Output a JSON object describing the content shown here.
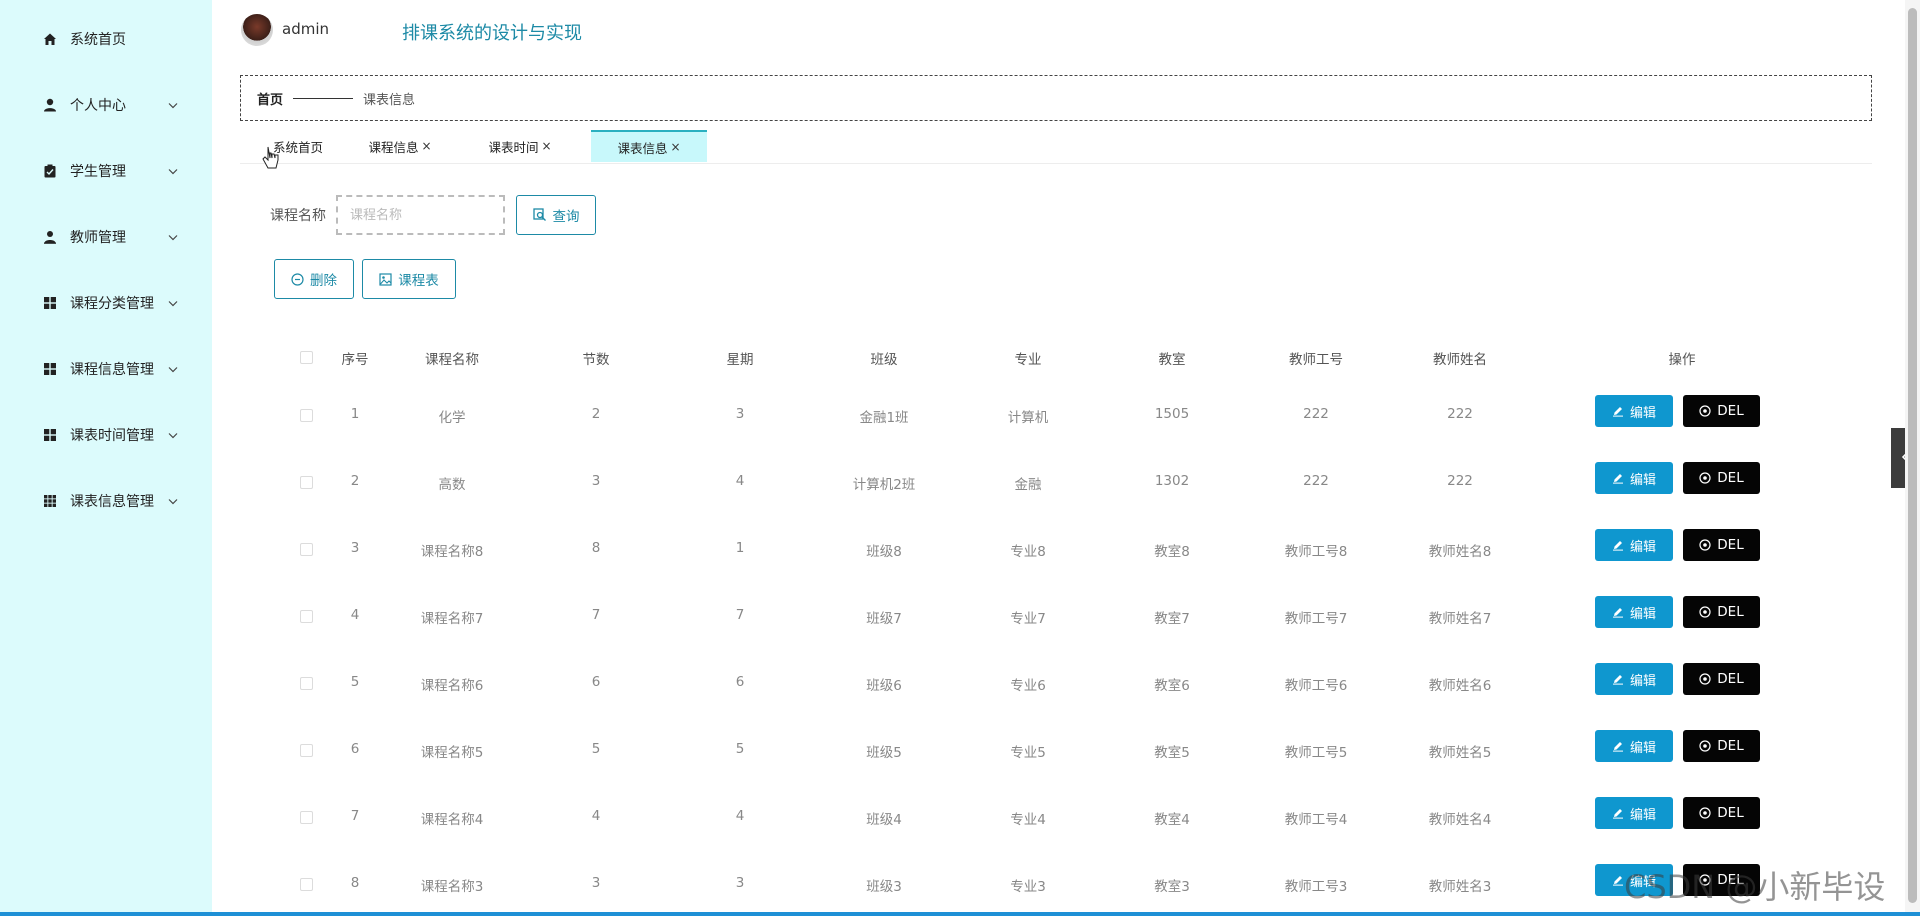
{
  "header": {
    "username": "admin",
    "system_title": "排课系统的设计与实现"
  },
  "sidebar": {
    "items": [
      {
        "label": "系统首页",
        "icon": "home-icon",
        "has_submenu": false
      },
      {
        "label": "个人中心",
        "icon": "user-icon",
        "has_submenu": true
      },
      {
        "label": "学生管理",
        "icon": "clipboard-icon",
        "has_submenu": true
      },
      {
        "label": "教师管理",
        "icon": "teacher-icon",
        "has_submenu": true
      },
      {
        "label": "课程分类管理",
        "icon": "grid-icon",
        "has_submenu": true
      },
      {
        "label": "课程信息管理",
        "icon": "grid-icon",
        "has_submenu": true
      },
      {
        "label": "课表时间管理",
        "icon": "grid-icon",
        "has_submenu": true
      },
      {
        "label": "课表信息管理",
        "icon": "grid-nine-icon",
        "has_submenu": true
      }
    ]
  },
  "breadcrumb": {
    "home": "首页",
    "current": "课表信息"
  },
  "tabs": [
    {
      "label": "系统首页",
      "closable": false,
      "active": false
    },
    {
      "label": "课程信息",
      "closable": true,
      "active": false
    },
    {
      "label": "课表时间",
      "closable": true,
      "active": false
    },
    {
      "label": "课表信息",
      "closable": true,
      "active": true
    }
  ],
  "tab_close_glyph": "×",
  "search": {
    "label": "课程名称",
    "placeholder": "课程名称",
    "value": "",
    "query_button": "查询"
  },
  "actions": {
    "delete_button": "删除",
    "schedule_button": "课程表"
  },
  "table": {
    "columns": [
      "序号",
      "课程名称",
      "节数",
      "星期",
      "班级",
      "专业",
      "教室",
      "教师工号",
      "教师姓名",
      "操作"
    ],
    "edit_label": "编辑",
    "del_label": "DEL",
    "rows": [
      [
        "1",
        "化学",
        "2",
        "3",
        "金融1班",
        "计算机",
        "1505",
        "222",
        "222"
      ],
      [
        "2",
        "高数",
        "3",
        "4",
        "计算机2班",
        "金融",
        "1302",
        "222",
        "222"
      ],
      [
        "3",
        "课程名称8",
        "8",
        "1",
        "班级8",
        "专业8",
        "教室8",
        "教师工号8",
        "教师姓名8"
      ],
      [
        "4",
        "课程名称7",
        "7",
        "7",
        "班级7",
        "专业7",
        "教室7",
        "教师工号7",
        "教师姓名7"
      ],
      [
        "5",
        "课程名称6",
        "6",
        "6",
        "班级6",
        "专业6",
        "教室6",
        "教师工号6",
        "教师姓名6"
      ],
      [
        "6",
        "课程名称5",
        "5",
        "5",
        "班级5",
        "专业5",
        "教室5",
        "教师工号5",
        "教师姓名5"
      ],
      [
        "7",
        "课程名称4",
        "4",
        "4",
        "班级4",
        "专业4",
        "教室4",
        "教师工号4",
        "教师姓名4"
      ],
      [
        "8",
        "课程名称3",
        "3",
        "3",
        "班级3",
        "专业3",
        "教室3",
        "教师工号3",
        "教师姓名3"
      ]
    ]
  },
  "watermark": "CSDN @小新毕设",
  "colors": {
    "sidebar_bg": "#dcfbfc",
    "accent": "#1d8aa6",
    "edit_button": "#0f97cf",
    "del_button": "#050505",
    "active_tab": "#c8f8fb"
  }
}
